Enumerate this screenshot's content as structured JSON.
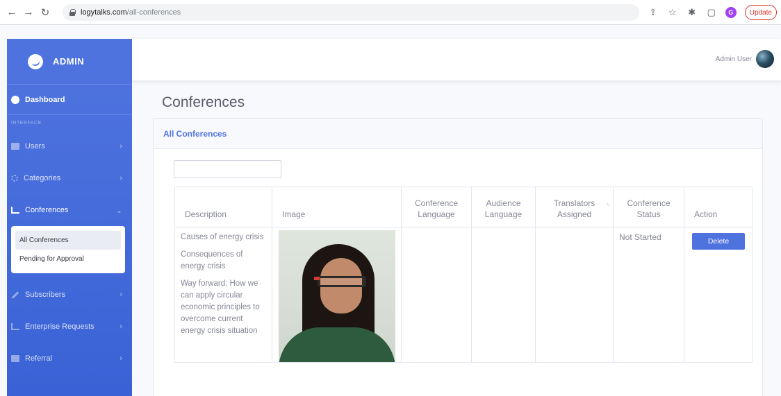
{
  "browser": {
    "url_host": "logytalks.com",
    "url_path": "/all-conferences",
    "profile_initial": "G",
    "update_label": "Update"
  },
  "sidebar": {
    "brand": "ADMIN",
    "dashboard": "Dashboard",
    "section_label": "INTERFACE",
    "items": [
      {
        "label": "Users"
      },
      {
        "label": "Categories"
      },
      {
        "label": "Conferences"
      },
      {
        "label": "Subscribers"
      },
      {
        "label": "Enterprise Requests"
      },
      {
        "label": "Referral"
      }
    ],
    "submenu": [
      "All Conferences",
      "Pending for Approval"
    ]
  },
  "topbar": {
    "user_name": "Admin User"
  },
  "main": {
    "page_title": "Conferences",
    "card_title": "All Conferences",
    "search_value": "",
    "columns": [
      "Description",
      "Image",
      "Conference Language",
      "Audience Language",
      "Translators Assigned",
      "Conference Status",
      "Action"
    ],
    "rows": [
      {
        "description": [
          "Causes of energy crisis",
          "Consequences of energy crisis",
          "Way forward: How we can apply circular economic principles to overcome current energy crisis situation"
        ],
        "conference_language": "",
        "audience_language": "",
        "translators_assigned": "",
        "status": "Not Started",
        "action": "Delete"
      }
    ]
  }
}
